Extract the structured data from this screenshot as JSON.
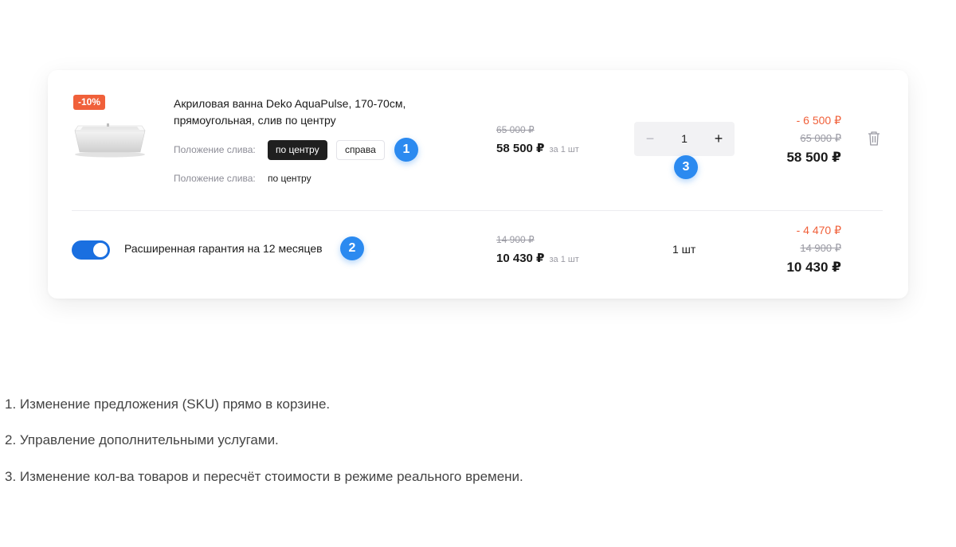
{
  "cart": {
    "product": {
      "discount_badge": "-10%",
      "title": "Акриловая ванна Deko AquaPulse, 170-70см, прямоугольная, слив по центру",
      "option_label": "Положение слива:",
      "options": [
        "по центру",
        "справа"
      ],
      "selected_label": "Положение слива:",
      "selected_value": "по центру",
      "old_price": "65 000 ₽",
      "price": "58 500 ₽",
      "per_unit": "за 1 шт",
      "quantity": "1",
      "minus": "−",
      "plus": "+",
      "discount_amount": "- 6 500 ₽",
      "total_old": "65 000 ₽",
      "total": "58 500 ₽"
    },
    "service": {
      "toggle_on": true,
      "label": "Расширенная гарантия на 12 месяцев",
      "old_price": "14 900 ₽",
      "price": "10 430 ₽",
      "per_unit": "за 1 шт",
      "quantity": "1 шт",
      "discount_amount": "- 4 470 ₽",
      "total_old": "14 900 ₽",
      "total": "10 430 ₽"
    },
    "markers": [
      "1",
      "2",
      "3"
    ]
  },
  "notes": [
    "1. Изменение предложения (SKU) прямо в корзине.",
    "2. Управление дополнительными услугами.",
    "3. Изменение кол-ва товаров и пересчёт стоимости в режиме реального времени."
  ],
  "colors": {
    "accent_blue": "#2b8af0",
    "discount_red": "#f0603a",
    "toggle_blue": "#1a6fe0"
  }
}
